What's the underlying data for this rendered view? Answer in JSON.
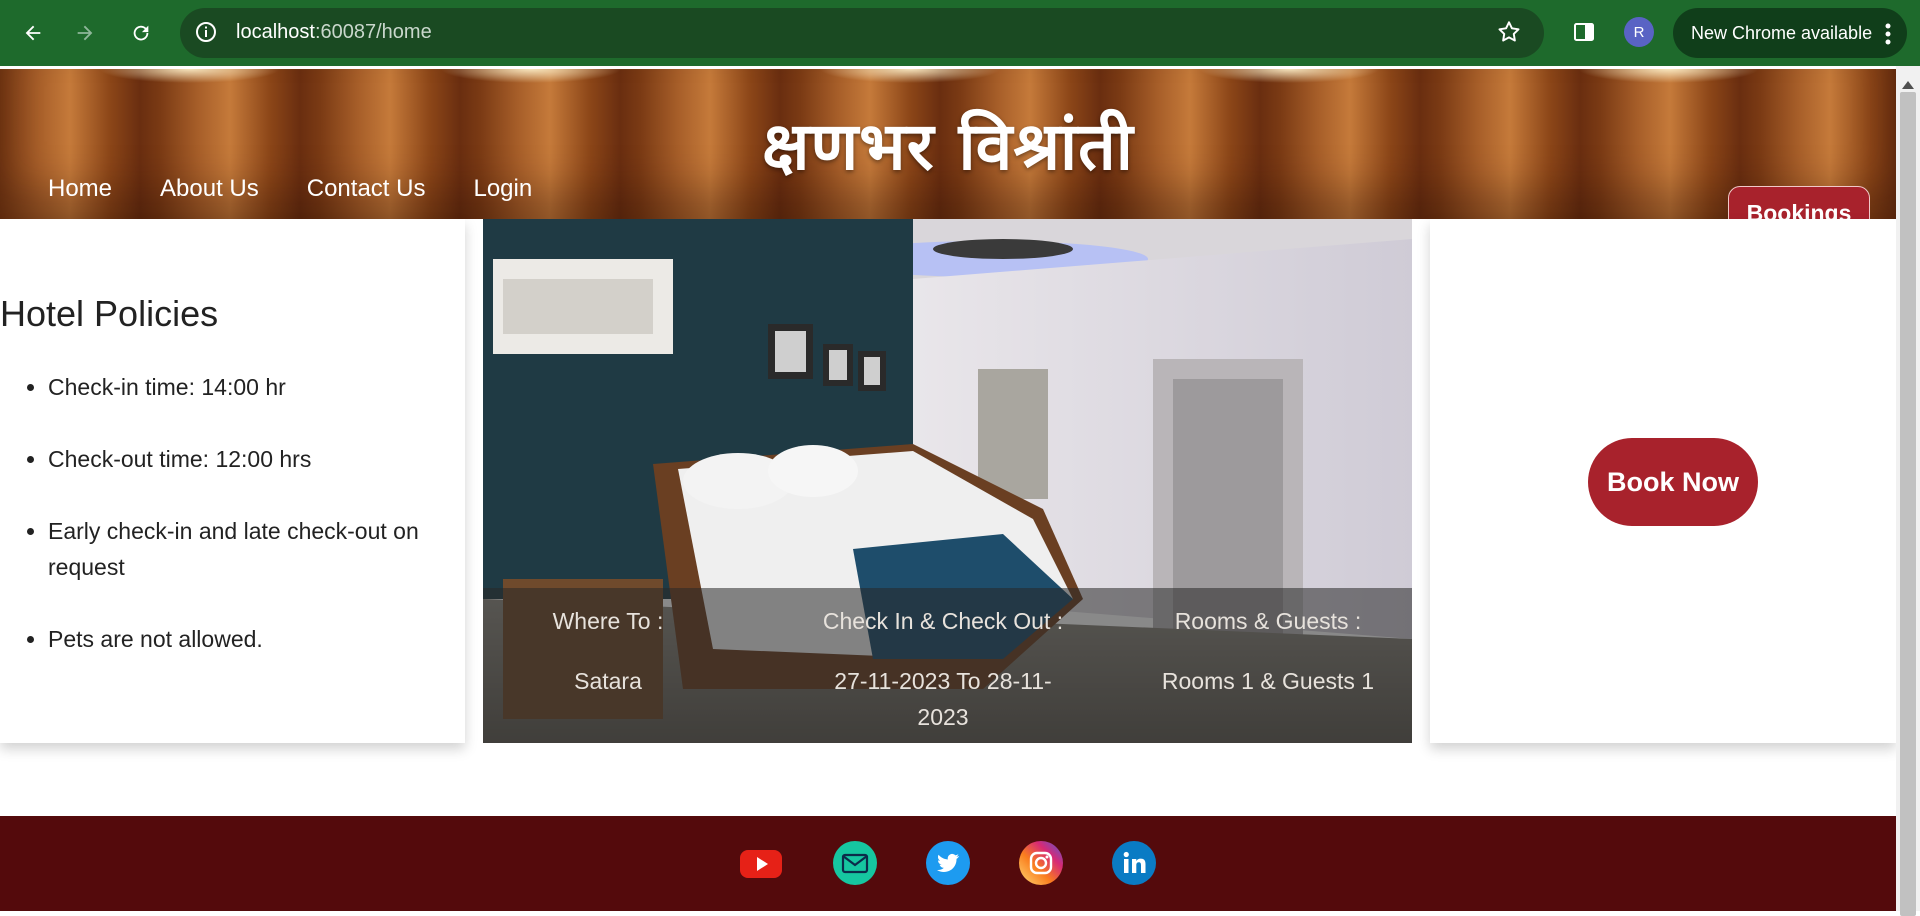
{
  "browser": {
    "url_host": "localhost",
    "url_path": ":60087/home",
    "profile_initial": "R",
    "update_label": "New Chrome available",
    "back_icon": "back-arrow-icon",
    "forward_icon": "forward-arrow-icon",
    "reload_icon": "reload-icon"
  },
  "header": {
    "site_title": "क्षणभर विश्रांती",
    "nav": [
      "Home",
      "About Us",
      "Contact Us",
      "Login"
    ],
    "bookings_label": "Bookings"
  },
  "policies": {
    "title": "Hotel Policies",
    "items": [
      "Check-in time: 14:00 hr",
      "Check-out time: 12:00 hrs",
      "Early check-in and late check-out on request",
      "Pets are not allowed."
    ]
  },
  "search_summary": {
    "where_label": "Where To :",
    "where_value": "Satara",
    "dates_label": "Check In & Check Out :",
    "dates_value": "27-11-2023 To 28-11-2023",
    "guests_label": "Rooms & Guests :",
    "guests_value": "Rooms 1 & Guests 1"
  },
  "cta": {
    "book_now_label": "Book Now"
  },
  "footer": {
    "social": [
      "youtube-icon",
      "email-icon",
      "twitter-icon",
      "instagram-icon",
      "linkedin-icon"
    ]
  },
  "colors": {
    "chrome_green": "#1e6a2c",
    "brand_red": "#a8222c",
    "footer_maroon": "#540a0c"
  }
}
